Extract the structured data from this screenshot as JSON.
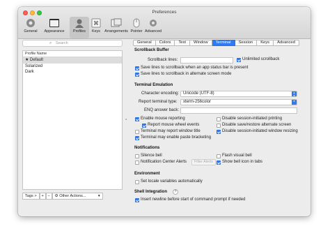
{
  "window": {
    "title": "Preferences"
  },
  "toolbar": {
    "items": [
      {
        "label": "General",
        "icon": "general-icon"
      },
      {
        "label": "Appearance",
        "icon": "appearance-icon"
      },
      {
        "label": "Profiles",
        "icon": "profiles-icon"
      },
      {
        "label": "Keys",
        "icon": "keys-icon"
      },
      {
        "label": "Arrangements",
        "icon": "arrangements-icon"
      },
      {
        "label": "Pointer",
        "icon": "pointer-icon"
      },
      {
        "label": "Advanced",
        "icon": "advanced-icon"
      }
    ],
    "selected": "Profiles"
  },
  "profiles": {
    "search_placeholder": "Search",
    "column_header": "Profile Name",
    "items": [
      "★ Default",
      "Solarized",
      "Dark"
    ],
    "selected": "★ Default",
    "tags_button": "Tags >",
    "add_button": "+",
    "remove_button": "−",
    "other_actions": "Other Actions...",
    "other_actions_arrow": "▾"
  },
  "tabs": [
    "General",
    "Colors",
    "Text",
    "Window",
    "Terminal",
    "Session",
    "Keys",
    "Advanced"
  ],
  "active_tab": "Terminal",
  "terminal": {
    "scrollback": {
      "heading": "Scrollback Buffer",
      "lines_label": "Scrollback lines:",
      "lines_value": "",
      "unlimited_label": "Unlimited scrollback",
      "unlimited_checked": true,
      "save_status_bar_label": "Save lines to scrollback when an app status bar is present",
      "save_status_bar_checked": true,
      "save_alternate_label": "Save lines to scrollback in alternate screen mode",
      "save_alternate_checked": true
    },
    "emulation": {
      "heading": "Terminal Emulation",
      "encoding_label": "Character encoding:",
      "encoding_value": "Unicode (UTF-8)",
      "report_type_label": "Report terminal type:",
      "report_type_value": "xterm-256color",
      "enq_label": "ENQ answer back:",
      "enq_value": "",
      "checkboxes_left": [
        {
          "label": "Enable mouse reporting",
          "checked": true
        },
        {
          "label": "Report mouse wheel events",
          "checked": true
        },
        {
          "label": "Terminal may report window title",
          "checked": false
        },
        {
          "label": "Terminal may enable paste bracketing",
          "checked": true
        }
      ],
      "checkboxes_right": [
        {
          "label": "Disable session-initiated printing",
          "checked": false
        },
        {
          "label": "Disable save/restore alternate screen",
          "checked": false
        },
        {
          "label": "Disable session-initiated window resizing",
          "checked": true
        }
      ]
    },
    "notifications": {
      "heading": "Notifications",
      "silence_bell": {
        "label": "Silence bell",
        "checked": false
      },
      "flash_visual_bell": {
        "label": "Flash visual bell",
        "checked": false
      },
      "notification_center": {
        "label": "Notification Center Alerts",
        "checked": false
      },
      "filter_alerts_button": "Filter Alerts",
      "show_bell_icon": {
        "label": "Show bell icon in tabs",
        "checked": true
      }
    },
    "environment": {
      "heading": "Environment",
      "set_locale": {
        "label": "Set locale variables automatically",
        "checked": false
      }
    },
    "shell_integration": {
      "heading": "Shell Integration",
      "help": "?",
      "insert_newline": {
        "label": "Insert newline before start of command prompt if needed",
        "checked": true
      }
    }
  },
  "colors": {
    "accent": "#2e7bf6",
    "window_bg": "#ececec"
  }
}
